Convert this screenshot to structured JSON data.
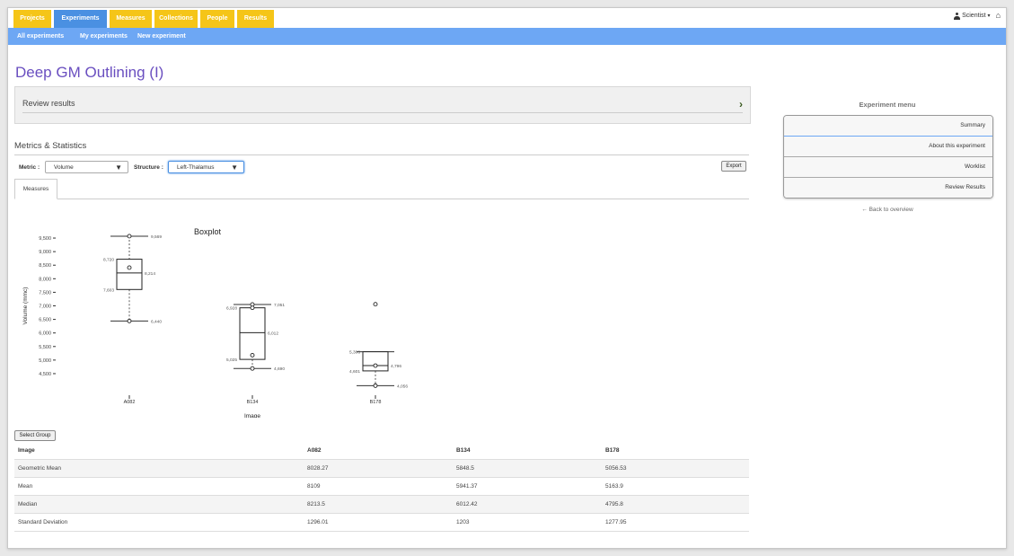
{
  "topnav": {
    "tabs": [
      "Projects",
      "Experiments",
      "Measures",
      "Collections",
      "People",
      "Results"
    ],
    "active": "Experiments",
    "user": "Scientist",
    "home_icon": "home-icon"
  },
  "subnav": {
    "links": [
      "All experiments",
      "My experiments",
      "New experiment"
    ]
  },
  "page": {
    "title": "Deep GM Outlining (I)"
  },
  "review": {
    "label": "Review results"
  },
  "metrics": {
    "section_title": "Metrics & Statistics",
    "metric_label": "Metric :",
    "metric_value": "Volume",
    "structure_label": "Structure :",
    "structure_value": "Left-Thalamus",
    "export_label": "Export",
    "tab_label": "Measures",
    "select_group_label": "Select Group"
  },
  "chart_data": {
    "type": "boxplot",
    "title": "Boxplot",
    "xlabel": "Image",
    "ylabel": "Volume (mmc)",
    "yticks": [
      4500,
      5000,
      5500,
      6000,
      6500,
      7000,
      7500,
      8000,
      8500,
      9000,
      9500
    ],
    "ytick_labels": [
      "4,500",
      "5,000",
      "5,500",
      "6,000",
      "6,500",
      "7,000",
      "7,500",
      "8,000",
      "8,500",
      "9,000",
      "9,500"
    ],
    "ylim": [
      4300,
      9700
    ],
    "categories": [
      "A082",
      "B134",
      "B178"
    ],
    "boxes": [
      {
        "name": "A082",
        "whisker_high": 9569,
        "q3": 8720,
        "median": 8214,
        "q1": 7603,
        "whisker_low": 6440,
        "points": [
          9569,
          8410,
          6440
        ],
        "labels": {
          "whisker_high": "9,569",
          "q3": "8,720",
          "median": "8,214",
          "q1": "7,603",
          "whisker_low": "6,440"
        }
      },
      {
        "name": "B134",
        "whisker_high": 7051,
        "q3": 6928,
        "median": 6012,
        "q1": 5025,
        "whisker_low": 4690,
        "points": [
          7051,
          6928,
          5180,
          4690
        ],
        "labels": {
          "whisker_high": "7,051",
          "q3": "6,928",
          "median": "6,012",
          "q1": "5,025",
          "whisker_low": "4,690"
        }
      },
      {
        "name": "B178",
        "whisker_high": 5306,
        "q3": 5306,
        "median": 4796,
        "q1": 4601,
        "whisker_low": 4056,
        "points": [
          7060,
          4796,
          4056
        ],
        "labels": {
          "q3": "5,306",
          "median": "4,796",
          "q1": "4,601",
          "whisker_low": "4,056"
        }
      }
    ]
  },
  "table": {
    "headers": [
      "Image",
      "A082",
      "B134",
      "B178"
    ],
    "rows": [
      [
        "Geometric Mean",
        "8028.27",
        "5848.5",
        "5056.53"
      ],
      [
        "Mean",
        "8109",
        "5941.37",
        "5163.9"
      ],
      [
        "Median",
        "8213.5",
        "6012.42",
        "4795.8"
      ],
      [
        "Standard Deviation",
        "1296.01",
        "1203",
        "1277.95"
      ]
    ]
  },
  "sidebar": {
    "title": "Experiment menu",
    "items": [
      "Summary",
      "About this experiment",
      "Worklist",
      "Review Results"
    ],
    "back_link": "← Back to overview"
  }
}
